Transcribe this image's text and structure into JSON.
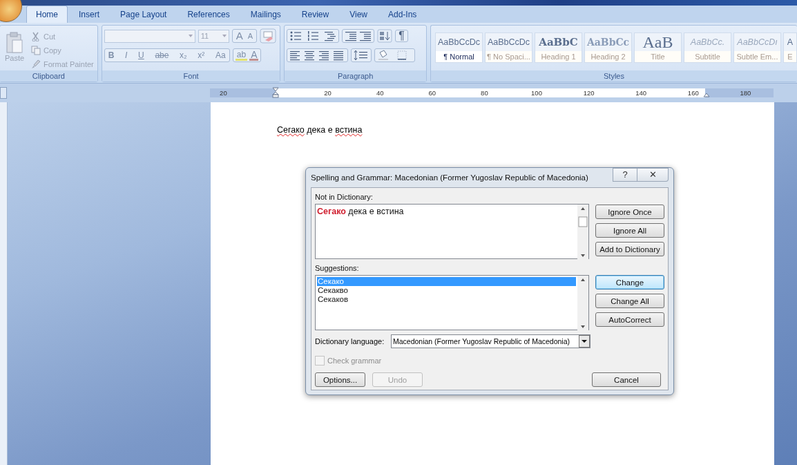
{
  "tabs": [
    {
      "label": "Home",
      "selected": true
    },
    {
      "label": "Insert",
      "selected": false
    },
    {
      "label": "Page Layout",
      "selected": false
    },
    {
      "label": "References",
      "selected": false
    },
    {
      "label": "Mailings",
      "selected": false
    },
    {
      "label": "Review",
      "selected": false
    },
    {
      "label": "View",
      "selected": false
    },
    {
      "label": "Add-Ins",
      "selected": false
    }
  ],
  "clipboard": {
    "paste": "Paste",
    "cut": "Cut",
    "copy": "Copy",
    "format_painter": "Format Painter",
    "label": "Clipboard"
  },
  "font": {
    "size": "11",
    "grow": "A",
    "shrink": "A",
    "buttons": [
      "B",
      "I",
      "U",
      "abe",
      "x₂",
      "x²",
      "Aa"
    ],
    "highlight": "ab",
    "font_color_letter": "A",
    "label": "Font"
  },
  "paragraph": {
    "pilcrow": "¶",
    "label": "Paragraph"
  },
  "styles": {
    "label": "Styles",
    "items": [
      {
        "preview": "AaBbCcDc",
        "name": "¶ Normal",
        "kind": "body",
        "selected": true
      },
      {
        "preview": "AaBbCcDc",
        "name": "¶ No Spaci...",
        "kind": "body",
        "selected": false
      },
      {
        "preview": "AaBbC",
        "name": "Heading 1",
        "kind": "heading",
        "selected": false
      },
      {
        "preview": "AaBbCc",
        "name": "Heading 2",
        "kind": "heading2",
        "selected": false
      },
      {
        "preview": "AaB",
        "name": "Title",
        "kind": "title",
        "selected": false
      },
      {
        "preview": "AaBbCc.",
        "name": "Subtitle",
        "kind": "italic",
        "selected": false
      },
      {
        "preview": "AaBbCcDı",
        "name": "Subtle Em...",
        "kind": "italic",
        "selected": false
      },
      {
        "preview": "A",
        "name": "E",
        "kind": "body",
        "selected": false
      }
    ]
  },
  "ruler": {
    "labels": [
      "20",
      "20",
      "40",
      "60",
      "80",
      "100",
      "120",
      "140",
      "160",
      "180"
    ]
  },
  "document": {
    "words": [
      {
        "text": "Сегако",
        "misspelled": true
      },
      {
        "text": "дека",
        "misspelled": false
      },
      {
        "text": "е",
        "misspelled": false
      },
      {
        "text": "встина",
        "misspelled": true
      }
    ]
  },
  "dialog": {
    "title": "Spelling and Grammar: Macedonian (Former Yugoslav Republic of Macedonia)",
    "help": "?",
    "close": "✕",
    "not_in_dictionary_label": "Not in Dictionary:",
    "sentence": "**Сегако** дека е встина",
    "suggestions_label": "Suggestions:",
    "suggestions": [
      {
        "text": "Секако",
        "selected": true
      },
      {
        "text": "Секакво",
        "selected": false
      },
      {
        "text": "Секаков",
        "selected": false
      }
    ],
    "top_buttons": [
      {
        "label": "Ignore Once",
        "focused": false
      },
      {
        "label": "Ignore All",
        "focused": false
      },
      {
        "label": "Add to Dictionary",
        "focused": false
      }
    ],
    "suggestion_buttons": [
      {
        "label": "Change",
        "focused": true
      },
      {
        "label": "Change All",
        "focused": false
      },
      {
        "label": "AutoCorrect",
        "focused": false
      }
    ],
    "language_label": "Dictionary language:",
    "language": "Macedonian (Former Yugoslav Republic of Macedonia)",
    "check_grammar": {
      "label": "Check grammar",
      "checked": false,
      "disabled": true
    },
    "options": "Options...",
    "undo": {
      "label": "Undo",
      "disabled": true
    },
    "cancel": "Cancel"
  }
}
